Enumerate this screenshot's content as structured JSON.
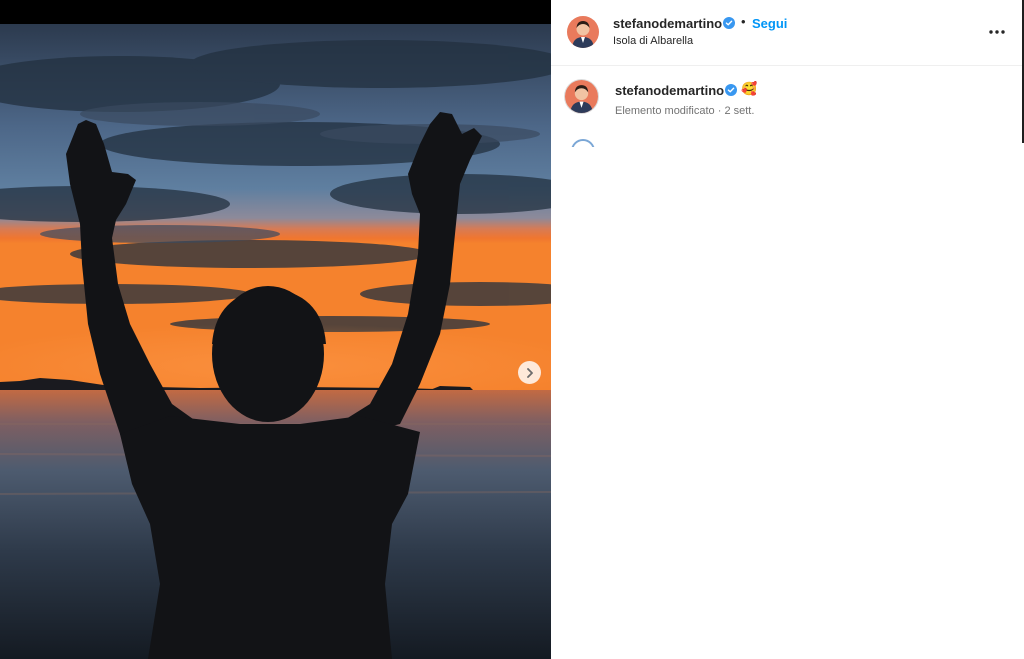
{
  "post": {
    "username": "stefanodemartino",
    "follow_label": "Segui",
    "separator": "•",
    "location": "Isola di Albarella",
    "more_icon": "more-horizontal-icon",
    "verified_icon": "verified-badge-icon",
    "next_icon": "chevron-right-icon"
  },
  "caption": {
    "username": "stefanodemartino",
    "emoji": "🥰",
    "edited_label": "Elemento modificato",
    "time_separator": " · ",
    "time": "2 sett."
  },
  "colors": {
    "accent": "#0095f6",
    "verified": "#3897f0",
    "text": "#262626",
    "muted": "#737373"
  }
}
